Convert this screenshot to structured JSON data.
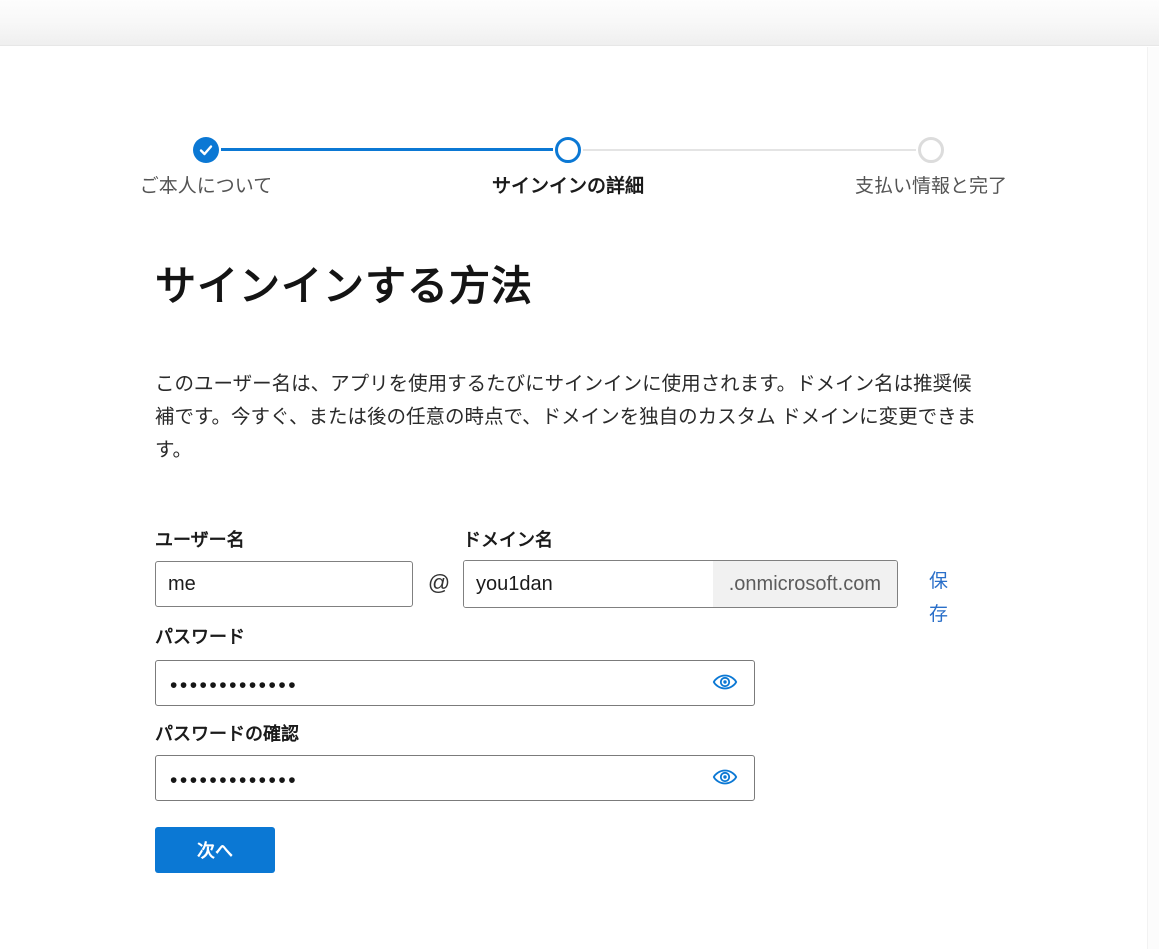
{
  "stepper": {
    "steps": [
      {
        "label": "ご本人について",
        "state": "completed"
      },
      {
        "label": "サインインの詳細",
        "state": "current"
      },
      {
        "label": "支払い情報と完了",
        "state": "upcoming"
      }
    ]
  },
  "page": {
    "title": "サインインする方法",
    "description": "このユーザー名は、アプリを使用するたびにサインインに使用されます。ドメイン名は推奨候補です。今すぐ、または後の任意の時点で、ドメインを独自のカスタム ドメインに変更できます。"
  },
  "form": {
    "username": {
      "label": "ユーザー名",
      "value": "me"
    },
    "at_separator": "@",
    "domain": {
      "label": "ドメイン名",
      "value": "you1dan",
      "suffix": ".onmicrosoft.com"
    },
    "save_link_label": "保存",
    "password": {
      "label": "パスワード",
      "masked_value": "•••••••••••••"
    },
    "confirm_password": {
      "label": "パスワードの確認",
      "masked_value": "•••••••••••••"
    },
    "next_button_label": "次へ"
  },
  "icons": {
    "completed_step": "check-icon",
    "show_password": "eye-icon"
  },
  "colors": {
    "accent_blue": "#0b78d4",
    "link_blue": "#2a6fc9",
    "inactive_gray": "#dcdcdc",
    "suffix_background": "#f1f1f1",
    "step_label_gray": "#545454"
  }
}
